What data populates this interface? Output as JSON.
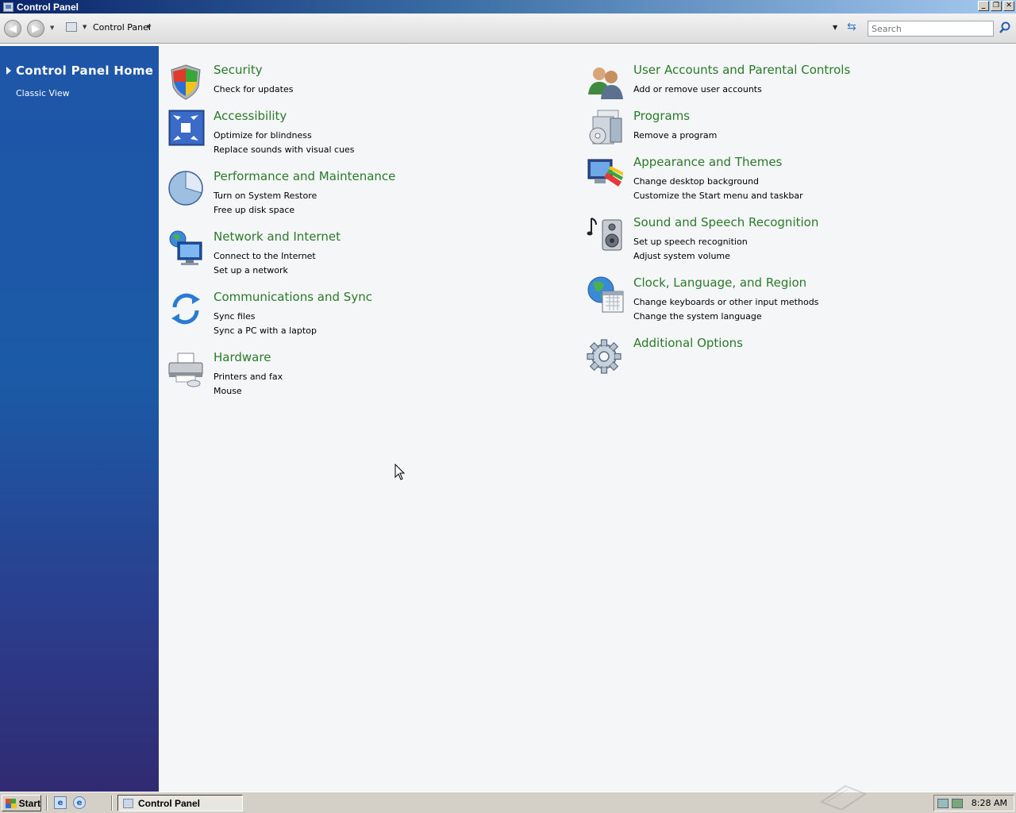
{
  "window": {
    "title": "Control Panel"
  },
  "toolbar": {
    "breadcrumb": "Control Panel",
    "search_placeholder": "Search"
  },
  "sidebar": {
    "home_label": "Control Panel Home",
    "classic_label": "Classic View"
  },
  "categories": [
    {
      "title": "Security",
      "links": [
        "Check for updates"
      ],
      "icon": "security-shield-icon"
    },
    {
      "title": "Accessibility",
      "links": [
        "Optimize for blindness",
        "Replace sounds with visual cues"
      ],
      "icon": "accessibility-icon"
    },
    {
      "title": "Performance and Maintenance",
      "links": [
        "Turn on System Restore",
        "Free up disk space"
      ],
      "icon": "performance-pie-icon"
    },
    {
      "title": "Network and Internet",
      "links": [
        "Connect to the Internet",
        "Set up a network"
      ],
      "icon": "network-globe-icon"
    },
    {
      "title": "Communications and Sync",
      "links": [
        "Sync files",
        "Sync a PC with a laptop"
      ],
      "icon": "sync-arrows-icon"
    },
    {
      "title": "Hardware",
      "links": [
        "Printers and fax",
        "Mouse"
      ],
      "icon": "printer-icon"
    },
    {
      "title": "User Accounts and Parental Controls",
      "links": [
        "Add or remove user accounts"
      ],
      "icon": "users-icon"
    },
    {
      "title": "Programs",
      "links": [
        "Remove a program"
      ],
      "icon": "programs-icon"
    },
    {
      "title": "Appearance and Themes",
      "links": [
        "Change desktop background",
        "Customize the Start menu and taskbar"
      ],
      "icon": "appearance-icon"
    },
    {
      "title": "Sound and Speech Recognition",
      "links": [
        "Set up speech recognition",
        "Adjust system volume"
      ],
      "icon": "speaker-icon"
    },
    {
      "title": "Clock, Language, and Region",
      "links": [
        "Change keyboards or other input methods",
        "Change the system language"
      ],
      "icon": "clock-globe-icon"
    },
    {
      "title": "Additional Options",
      "links": [],
      "icon": "gear-icon"
    }
  ],
  "taskbar": {
    "start_label": "Start",
    "task_label": "Control Panel",
    "clock": "8:28 AM"
  },
  "colors": {
    "category_title": "#2a7a2a",
    "sidebar_top": "#1e55a8",
    "sidebar_bottom": "#302a72"
  }
}
